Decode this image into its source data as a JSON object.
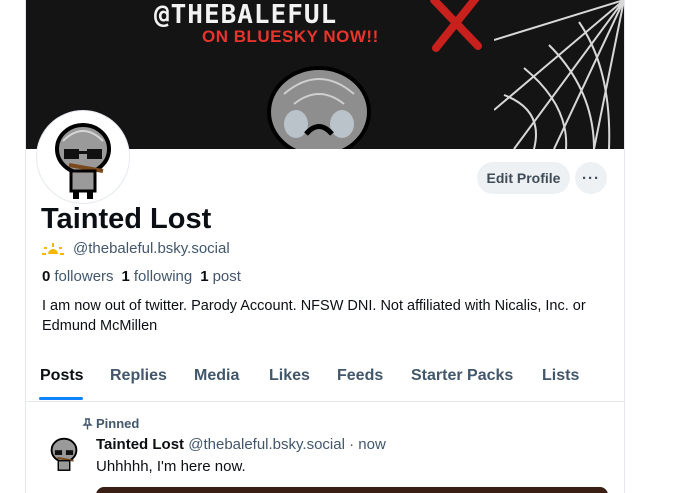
{
  "banner": {
    "handle_text": "@THEBALEFUL",
    "subtitle": "ON BLUESKY NOW!!"
  },
  "profile": {
    "display_name": "Tainted Lost",
    "handle": "@thebaleful.bsky.social",
    "followers_count": "0",
    "followers_label": "followers",
    "following_count": "1",
    "following_label": "following",
    "posts_count": "1",
    "posts_label": "post",
    "bio": "I am now out of twitter. Parody Account. NFSW DNI. Not affiliated with Nicalis, Inc. or Edmund McMillen"
  },
  "actions": {
    "edit_profile": "Edit Profile",
    "more": "···"
  },
  "tabs": [
    {
      "label": "Posts",
      "active": true
    },
    {
      "label": "Replies",
      "active": false
    },
    {
      "label": "Media",
      "active": false
    },
    {
      "label": "Likes",
      "active": false
    },
    {
      "label": "Feeds",
      "active": false
    },
    {
      "label": "Starter Packs",
      "active": false
    },
    {
      "label": "Lists",
      "active": false
    }
  ],
  "post": {
    "pinned_label": "Pinned",
    "author_name": "Tainted Lost",
    "author_handle": "@thebaleful.bsky.social",
    "separator": "·",
    "time": "now",
    "text": "Uhhhhh, I'm here now."
  },
  "colors": {
    "accent": "#1083fe",
    "banner_red": "#e8342c",
    "muted_text": "#42576c"
  }
}
